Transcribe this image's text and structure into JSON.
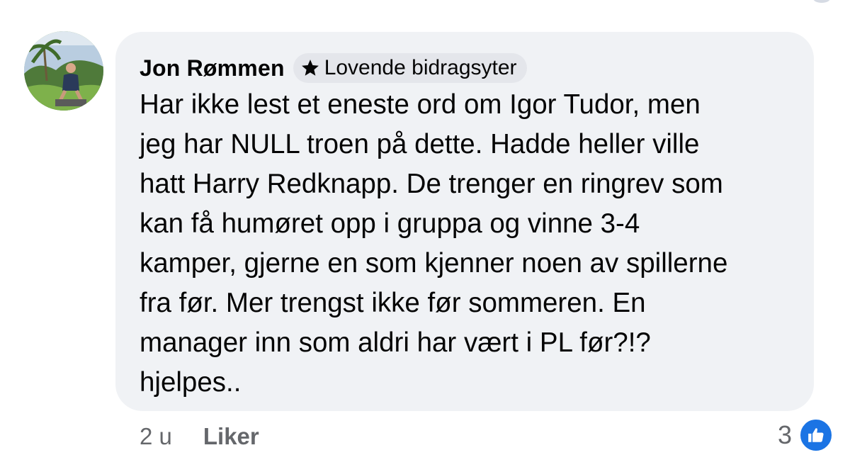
{
  "comment": {
    "author": "Jon Rømmen",
    "badge": {
      "icon": "star-icon",
      "label": "Lovende bidragsyter"
    },
    "text_lines": [
      "Har ikke lest et eneste ord om Igor Tudor, men",
      "jeg har NULL troen på dette. Hadde heller ville",
      "hatt Harry Redknapp. De trenger en ringrev som",
      "kan få humøret opp i gruppa og vinne 3-4",
      "kamper, gjerne en som kjenner noen av spillerne",
      "fra før. Mer trengst ikke før sommeren. En",
      "manager inn som aldri har vært i PL før?!?",
      "hjelpes.."
    ]
  },
  "footer": {
    "time": "2 u",
    "like_label": "Liker",
    "reaction_count": "3",
    "reaction_icon": "thumbs-up-icon"
  },
  "colors": {
    "bubble_bg": "#f0f2f5",
    "badge_bg": "#e4e6eb",
    "text": "#050505",
    "secondary_text": "#65676b",
    "like_blue": "#1b74e4"
  }
}
